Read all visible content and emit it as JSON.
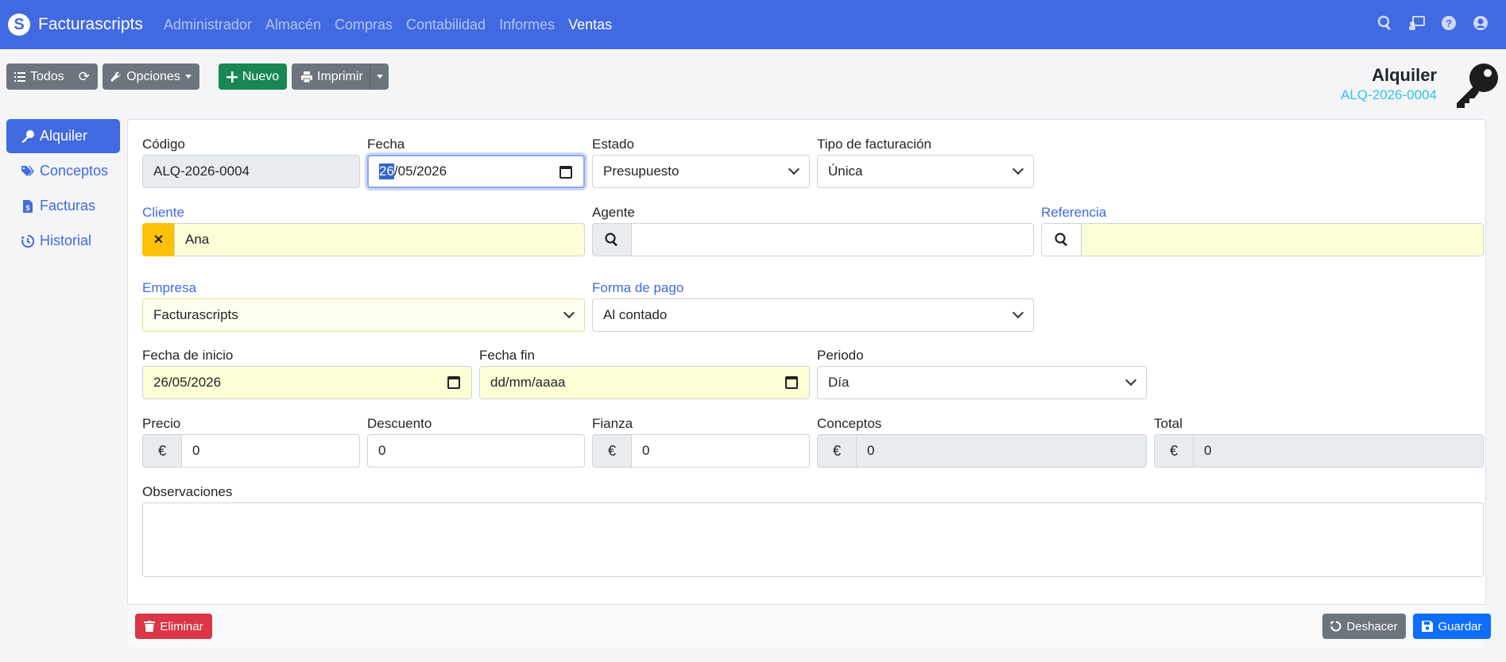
{
  "navbar": {
    "brand": "Facturascripts",
    "links": [
      "Administrador",
      "Almacén",
      "Compras",
      "Contabilidad",
      "Informes",
      "Ventas"
    ],
    "active": "Ventas"
  },
  "toolbar": {
    "todos": "Todos",
    "opciones": "Opciones",
    "nuevo": "Nuevo",
    "imprimir": "Imprimir"
  },
  "header": {
    "title": "Alquiler",
    "code": "ALQ-2026-0004"
  },
  "sidebar": {
    "items": [
      {
        "label": "Alquiler",
        "icon": "key-icon"
      },
      {
        "label": "Conceptos",
        "icon": "tags-icon"
      },
      {
        "label": "Facturas",
        "icon": "invoice-icon"
      },
      {
        "label": "Historial",
        "icon": "history-icon"
      }
    ]
  },
  "form": {
    "codigo": {
      "label": "Código",
      "value": "ALQ-2026-0004"
    },
    "fecha": {
      "label": "Fecha",
      "value_selected": "26",
      "value_rest": "/05/2026"
    },
    "estado": {
      "label": "Estado",
      "value": "Presupuesto"
    },
    "tipo_facturacion": {
      "label": "Tipo de facturación",
      "value": "Única"
    },
    "cliente": {
      "label": "Cliente",
      "value": "Ana",
      "clear": "✕"
    },
    "agente": {
      "label": "Agente",
      "value": ""
    },
    "referencia": {
      "label": "Referencia",
      "value": ""
    },
    "empresa": {
      "label": "Empresa",
      "value": "Facturascripts"
    },
    "forma_pago": {
      "label": "Forma de pago",
      "value": "Al contado"
    },
    "fecha_inicio": {
      "label": "Fecha de inicio",
      "value": "26/05/2026"
    },
    "fecha_fin": {
      "label": "Fecha fin",
      "value": "dd/mm/aaaa"
    },
    "periodo": {
      "label": "Periodo",
      "value": "Día"
    },
    "precio": {
      "label": "Precio",
      "value": "0",
      "currency": "€"
    },
    "descuento": {
      "label": "Descuento",
      "value": "0"
    },
    "fianza": {
      "label": "Fianza",
      "value": "0",
      "currency": "€"
    },
    "conceptos": {
      "label": "Conceptos",
      "value": "0",
      "currency": "€"
    },
    "total": {
      "label": "Total",
      "value": "0",
      "currency": "€"
    },
    "observaciones": {
      "label": "Observaciones",
      "value": ""
    }
  },
  "footer": {
    "eliminar": "Eliminar",
    "deshacer": "Deshacer",
    "guardar": "Guardar"
  }
}
